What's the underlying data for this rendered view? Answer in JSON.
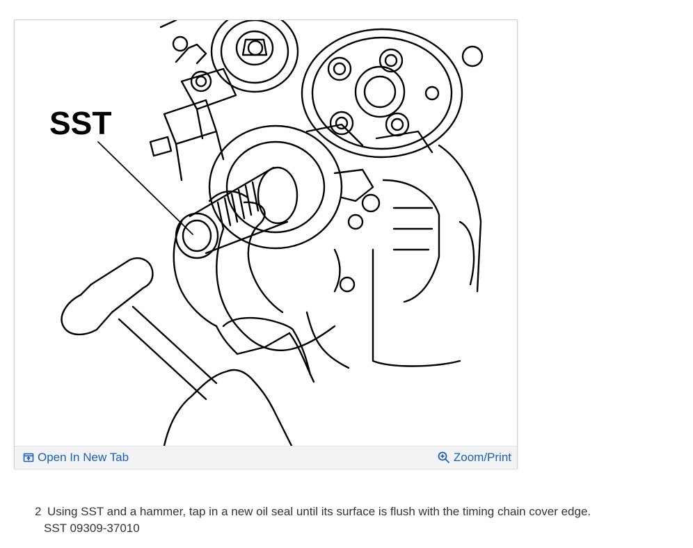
{
  "figure": {
    "callout_label": "SST",
    "open_new_tab_label": "Open In New Tab",
    "zoom_print_label": "Zoom/Print",
    "open_icon": "open-in-new-tab-icon",
    "zoom_icon": "zoom-in-icon",
    "link_color": "#1a5fb4"
  },
  "instructions": {
    "step_number": "2",
    "step_text": "Using SST and a hammer, tap in a new oil seal until its surface is flush with the timing chain cover edge.",
    "sst_text": "SST 09309-37010"
  }
}
